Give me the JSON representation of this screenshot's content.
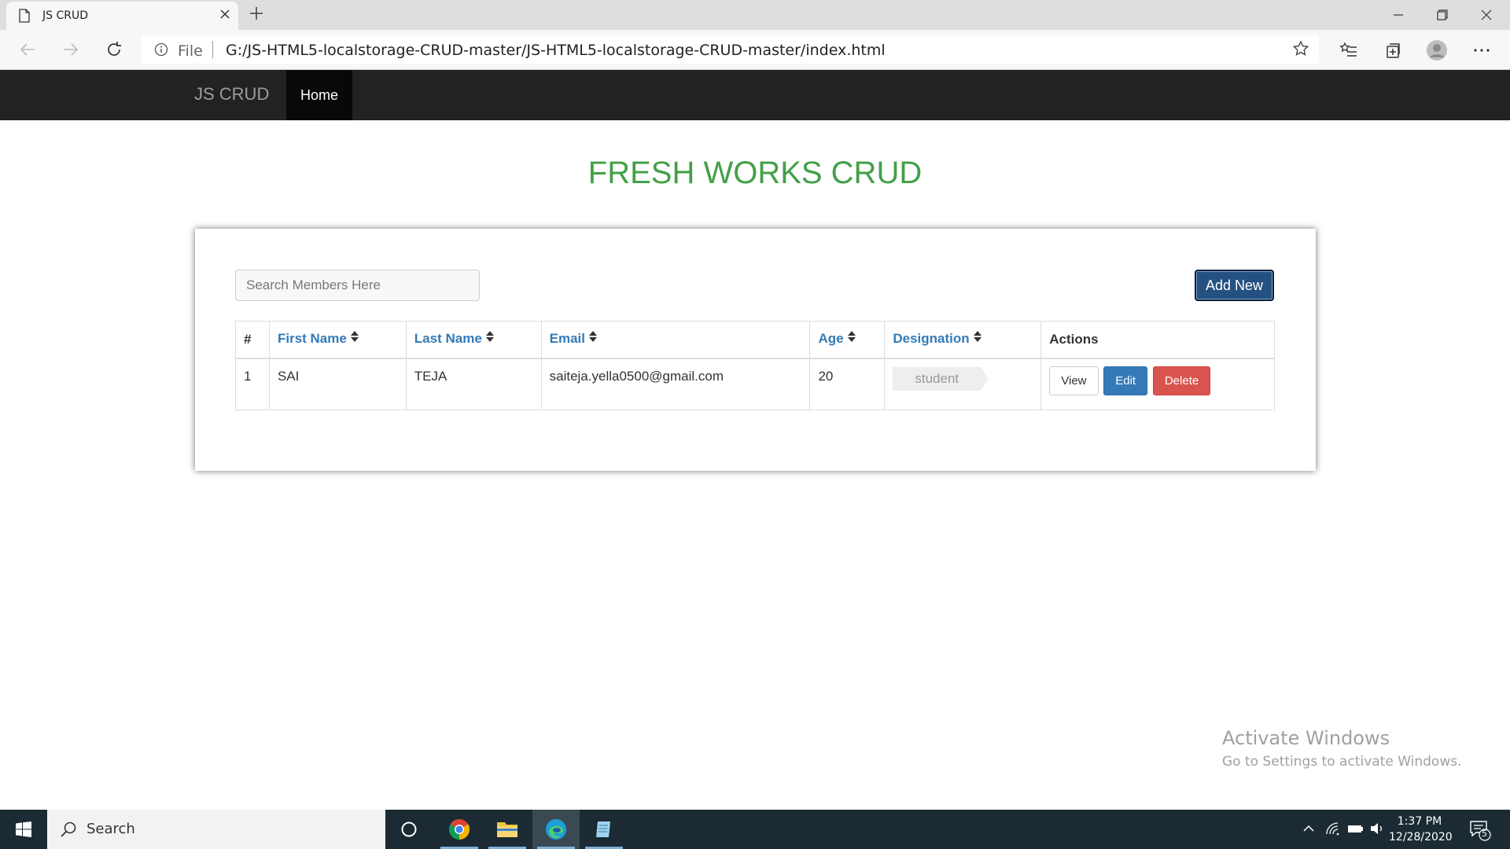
{
  "browser": {
    "tab_title": "JS CRUD",
    "url_protocol": "File",
    "url": "G:/JS-HTML5-localstorage-CRUD-master/JS-HTML5-localstorage-CRUD-master/index.html"
  },
  "navbar": {
    "brand": "JS CRUD",
    "items": [
      {
        "label": "Home",
        "active": true
      }
    ]
  },
  "page": {
    "heading": "FRESH WORKS CRUD",
    "heading_color": "#43a047",
    "search_placeholder": "Search Members Here",
    "add_new_label": "Add New"
  },
  "table": {
    "headers": {
      "index": "#",
      "first_name": "First Name",
      "last_name": "Last Name",
      "email": "Email",
      "age": "Age",
      "designation": "Designation",
      "actions": "Actions"
    },
    "rows": [
      {
        "index": "1",
        "first_name": "SAI",
        "last_name": "TEJA",
        "email": "saiteja.yella0500@gmail.com",
        "age": "20",
        "designation": "student"
      }
    ],
    "action_labels": {
      "view": "View",
      "edit": "Edit",
      "delete": "Delete"
    }
  },
  "watermark": {
    "line1": "Activate Windows",
    "line2": "Go to Settings to activate Windows."
  },
  "taskbar": {
    "search_label": "Search",
    "time": "1:37 PM",
    "date": "12/28/2020",
    "notification_count": "5"
  },
  "colors": {
    "navbar_bg": "#222222",
    "primary": "#337ab7",
    "danger": "#d9534f",
    "add_new_bg": "#255181"
  }
}
